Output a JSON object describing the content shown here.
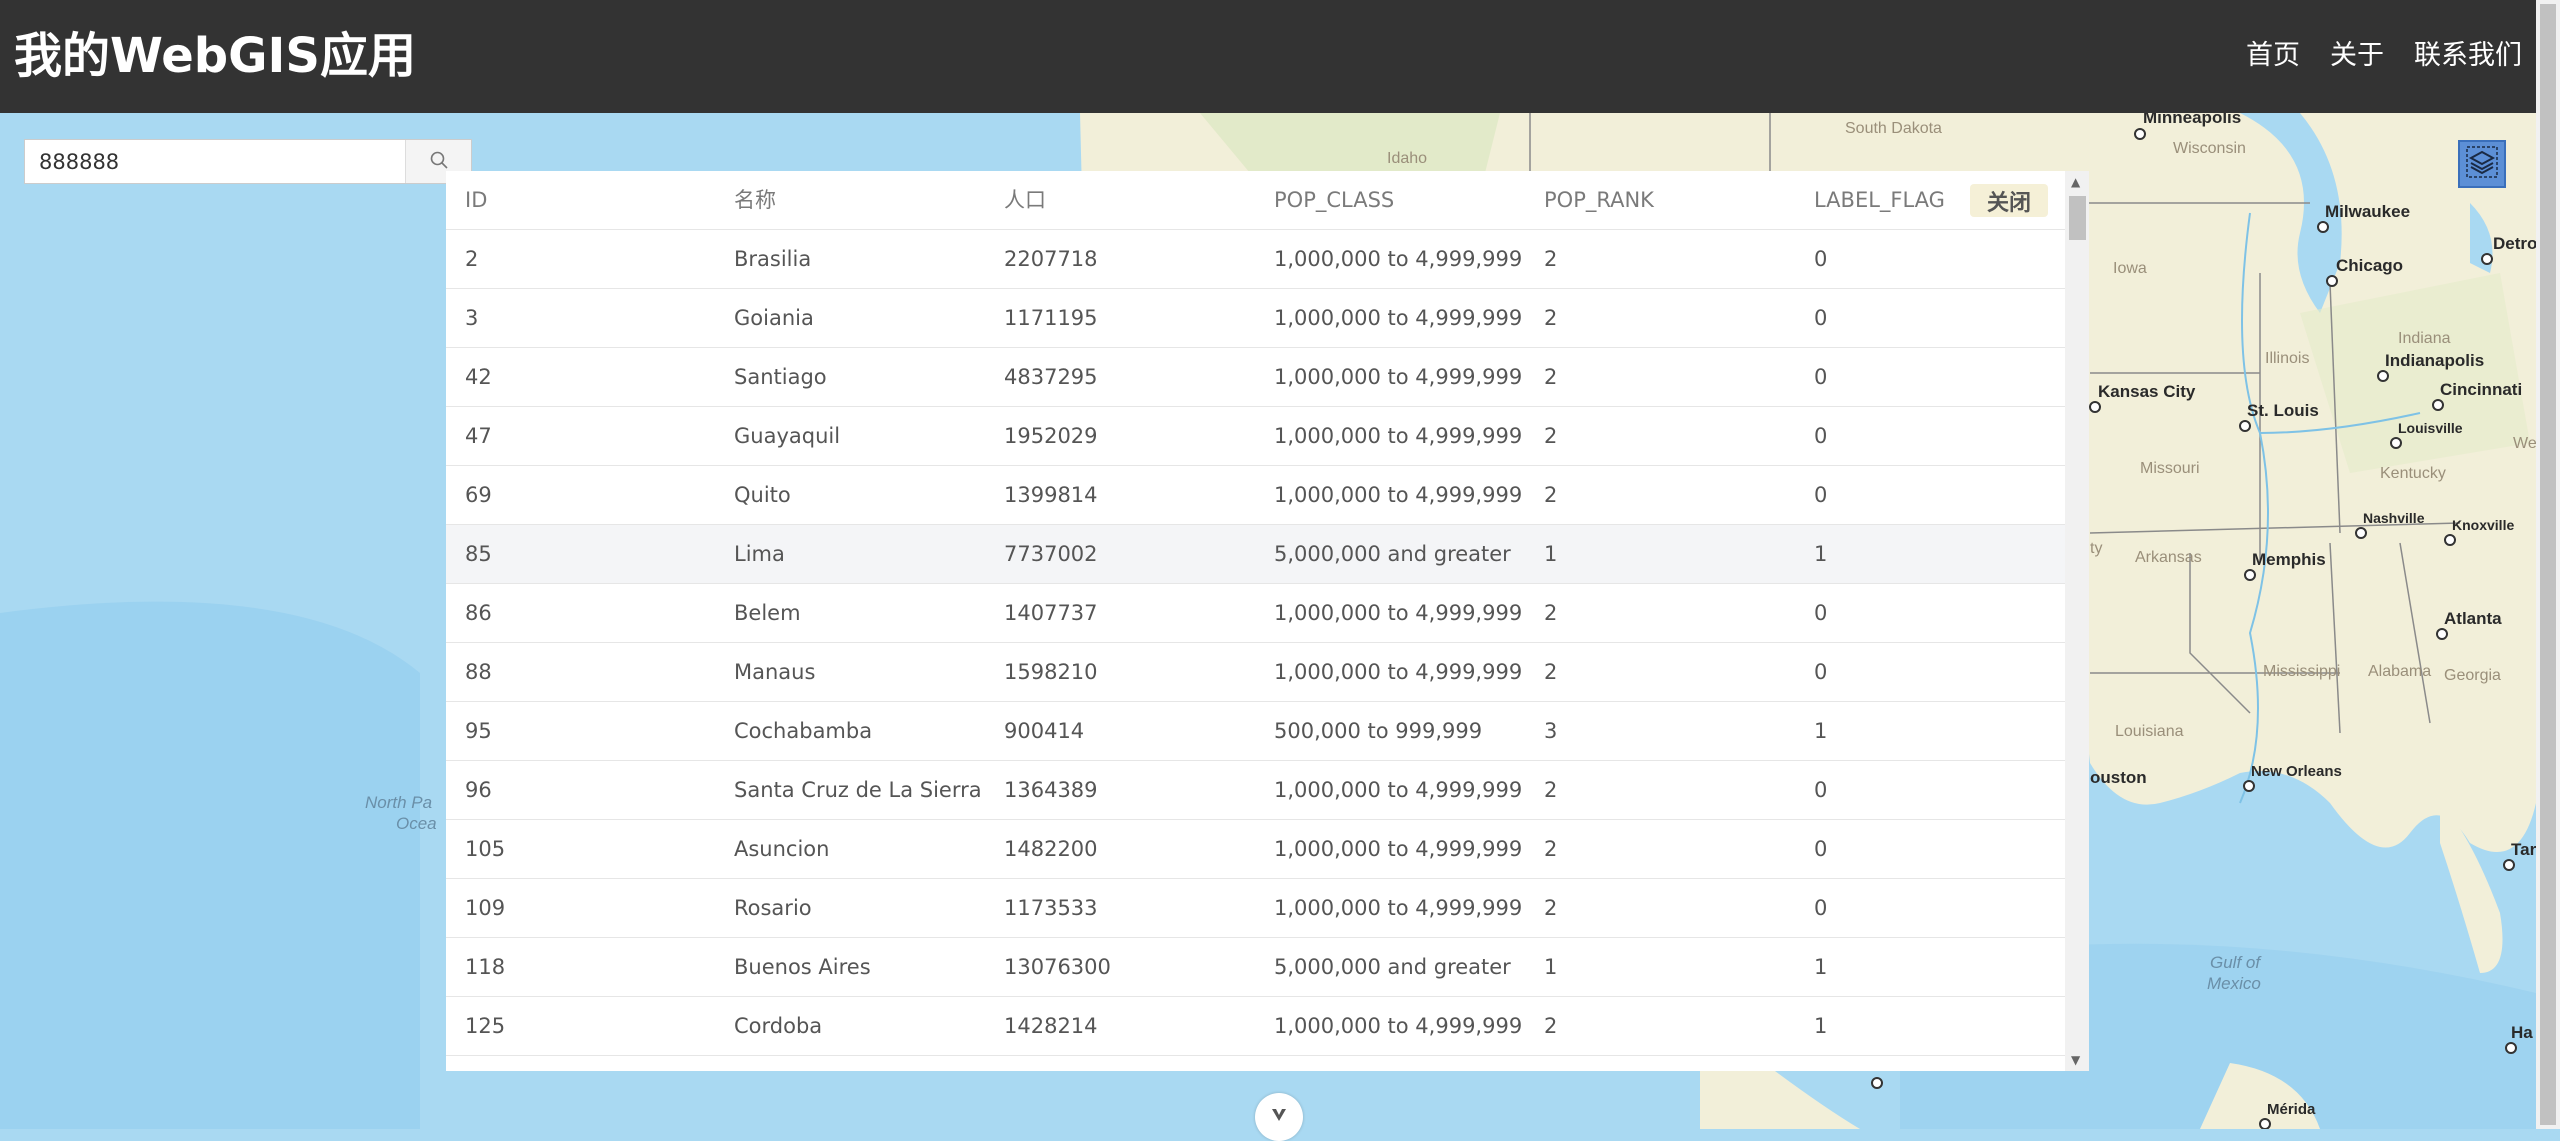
{
  "app": {
    "title": "我的WebGIS应用"
  },
  "nav": {
    "home": "首页",
    "about": "关于",
    "contact": "联系我们"
  },
  "search": {
    "value": "888888",
    "placeholder": ""
  },
  "table": {
    "close_label": "关闭",
    "columns": [
      "ID",
      "名称",
      "人口",
      "POP_CLASS",
      "POP_RANK",
      "LABEL_FLAG"
    ],
    "rows": [
      [
        "2",
        "Brasilia",
        "2207718",
        "1,000,000 to 4,999,999",
        "2",
        "0"
      ],
      [
        "3",
        "Goiania",
        "1171195",
        "1,000,000 to 4,999,999",
        "2",
        "0"
      ],
      [
        "42",
        "Santiago",
        "4837295",
        "1,000,000 to 4,999,999",
        "2",
        "0"
      ],
      [
        "47",
        "Guayaquil",
        "1952029",
        "1,000,000 to 4,999,999",
        "2",
        "0"
      ],
      [
        "69",
        "Quito",
        "1399814",
        "1,000,000 to 4,999,999",
        "2",
        "0"
      ],
      [
        "85",
        "Lima",
        "7737002",
        "5,000,000 and greater",
        "1",
        "1"
      ],
      [
        "86",
        "Belem",
        "1407737",
        "1,000,000 to 4,999,999",
        "2",
        "0"
      ],
      [
        "88",
        "Manaus",
        "1598210",
        "1,000,000 to 4,999,999",
        "2",
        "0"
      ],
      [
        "95",
        "Cochabamba",
        "900414",
        "500,000 to 999,999",
        "3",
        "1"
      ],
      [
        "96",
        "Santa Cruz de La Sierra",
        "1364389",
        "1,000,000 to 4,999,999",
        "2",
        "0"
      ],
      [
        "105",
        "Asuncion",
        "1482200",
        "1,000,000 to 4,999,999",
        "2",
        "0"
      ],
      [
        "109",
        "Rosario",
        "1173533",
        "1,000,000 to 4,999,999",
        "2",
        "0"
      ],
      [
        "118",
        "Buenos Aires",
        "13076300",
        "5,000,000 and greater",
        "1",
        "1"
      ],
      [
        "125",
        "Cordoba",
        "1428214",
        "1,000,000 to 4,999,999",
        "2",
        "1"
      ]
    ],
    "highlighted_row": "85"
  },
  "map": {
    "cities": [
      "Minneapolis",
      "Milwaukee",
      "Chicago",
      "Detro",
      "Indianapolis",
      "Cincinnati",
      "Kansas City",
      "St. Louis",
      "Louisville",
      "Nashville",
      "Knoxville",
      "Memphis",
      "Atlanta",
      "New Orleans",
      "ouston",
      "Tar",
      "Ha",
      "Mérida"
    ],
    "regions": [
      "South Dakota",
      "Idaho",
      "Wisconsin",
      "Iowa",
      "Illinois",
      "Indiana",
      "Missouri",
      "Kentucky",
      "Arkansas",
      "Mississippi",
      "Alabama",
      "Georgia",
      "Louisiana",
      "ty",
      "We"
    ],
    "water_labels": [
      "Gulf of",
      "Mexico",
      "North Pa",
      "Ocea"
    ],
    "colors": {
      "ocean": "#a9d9f2",
      "land": "#f2efd9",
      "header": "#333333"
    }
  },
  "icons": {
    "search": "search-icon",
    "layers": "layers-icon",
    "toggle": "chevron-down-icon"
  }
}
